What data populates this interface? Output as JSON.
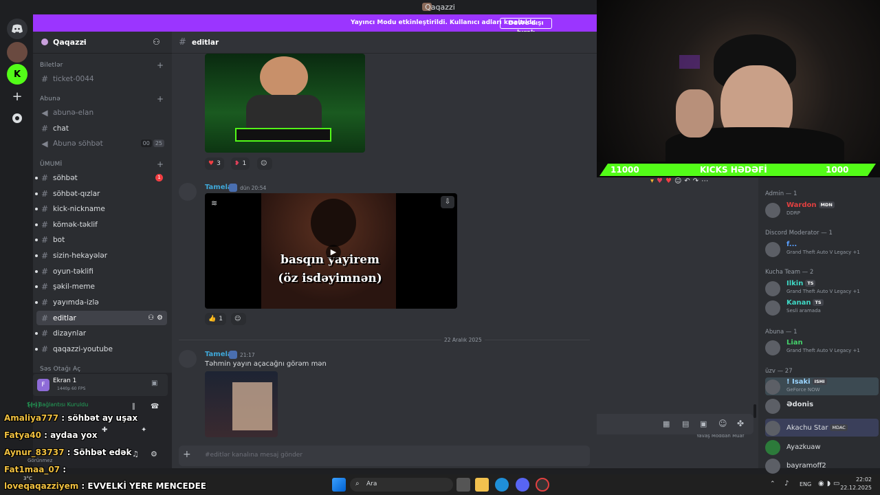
{
  "window": {
    "title": "Qaqazzi"
  },
  "streamer_banner": {
    "text": "Yayıncı Modu etkinleştirildi. Kullanıcı adları kısaltıldı.",
    "button": "Devre dışı bırak"
  },
  "server": {
    "name": "Qaqazzi"
  },
  "categories": {
    "biletlar": "Biletlər",
    "abuna": "Abunə",
    "umumi": "ÜMUMİ",
    "ses": "Səs Otağı Aç"
  },
  "channels": [
    {
      "name": "ticket-0044"
    },
    {
      "name": "abunə-elan"
    },
    {
      "name": "chat"
    },
    {
      "name": "Abunə söhbət",
      "count_a": "00",
      "count_b": "25"
    },
    {
      "name": "söhbət",
      "badge": "1"
    },
    {
      "name": "söhbət-qızlar"
    },
    {
      "name": "kick-nickname"
    },
    {
      "name": "kömək-təklif"
    },
    {
      "name": "bot"
    },
    {
      "name": "sizin-hekayələr"
    },
    {
      "name": "oyun-təklifi"
    },
    {
      "name": "şəkil-meme"
    },
    {
      "name": "yayımda-izlə"
    },
    {
      "name": "editlar"
    },
    {
      "name": "dizaynlar"
    },
    {
      "name": "qaqazzi-youtube"
    }
  ],
  "chat_header": {
    "channel": "editlar"
  },
  "messages": [
    {
      "author": "Tamela",
      "time": "dün 20:54",
      "video_caption_1": "basqın yayirem",
      "video_caption_2": "(öz isdəyimnən)"
    },
    {
      "author": "Tamela",
      "time": "21:17",
      "text": "Təhmin yayın açacağnı görəm mən"
    }
  ],
  "reactions": {
    "first": [
      {
        "emoji": "heart",
        "count": "3"
      },
      {
        "emoji": "heart2",
        "count": "1"
      }
    ],
    "second": [
      {
        "emoji": "thumbs-up",
        "count": "1"
      }
    ]
  },
  "date_divider": "22 Aralık 2025",
  "slowmode": "Yavaş Moddan Muaf",
  "composer": {
    "placeholder": "#editlər kanalına mesaj gönder"
  },
  "voice": {
    "screen_title": "Ekran 1",
    "screen_sub": "1440p 60 FPS",
    "connected": "Ses Bağlantısı Kuruldu",
    "user_status": "Görünmez"
  },
  "kicks_goal": {
    "left": "11000",
    "label": "KICKS HƏDƏFİ",
    "right": "1000"
  },
  "members": {
    "groups": [
      {
        "title": "Admin — 1"
      },
      {
        "title": "Discord Moderator — 1"
      },
      {
        "title": "Kucha Team — 2"
      },
      {
        "title": "Abuna — 1"
      },
      {
        "title": "üzv — 27"
      }
    ],
    "people": [
      {
        "name": "Wardon",
        "tag": "MDN",
        "sub": "DDRP",
        "color": "#e34040"
      },
      {
        "name": "f...",
        "sub": "Grand Theft Auto V Legacy +1",
        "color": "#5aa0ff"
      },
      {
        "name": "Ilkin",
        "tag": "TS",
        "sub": "Grand Theft Auto V Legacy +1",
        "color": "#3fd7c4"
      },
      {
        "name": "Kanan",
        "tag": "TS",
        "sub": "Sesli aramada",
        "color": "#3fd7c4"
      },
      {
        "name": "Lian",
        "sub": "Grand Theft Auto V Legacy +1",
        "color": "#44d16b"
      },
      {
        "name": "! Isaki",
        "tag": "ISHI",
        "sub": "GeForce NOW",
        "color": "#9ad4ff"
      },
      {
        "name": "Ədonis",
        "sub": "",
        "color": "#dbdee1"
      },
      {
        "name": "Akachu Star",
        "tag": "MDAC",
        "sub": "",
        "color": "#dbdee1"
      },
      {
        "name": "Ayazkuaw",
        "sub": "",
        "color": "#dbdee1"
      },
      {
        "name": "bayramoff2",
        "sub": "",
        "color": "#dbdee1"
      }
    ]
  },
  "stream_chat": [
    {
      "user": "Amaliya777",
      "msg": "söhbət ay uşax"
    },
    {
      "user": "Fatya40",
      "msg": "aydaa yox"
    },
    {
      "user": "Aynur_83737",
      "msg": "Söhbət edək"
    },
    {
      "user": "Fat1maa_07",
      "msg": ""
    },
    {
      "user": "loveqaqazziyem",
      "msg": "EVVELKİ YERE MENCEDEE"
    }
  ],
  "taskbar": {
    "search": "Ara",
    "lang": "ENG",
    "time": "22:02",
    "date": "22.12.2025",
    "temp": "3°C"
  },
  "colors": {
    "accent": "#9b35ff",
    "kick_green": "#53fc18",
    "discord_bg": "#313338"
  }
}
